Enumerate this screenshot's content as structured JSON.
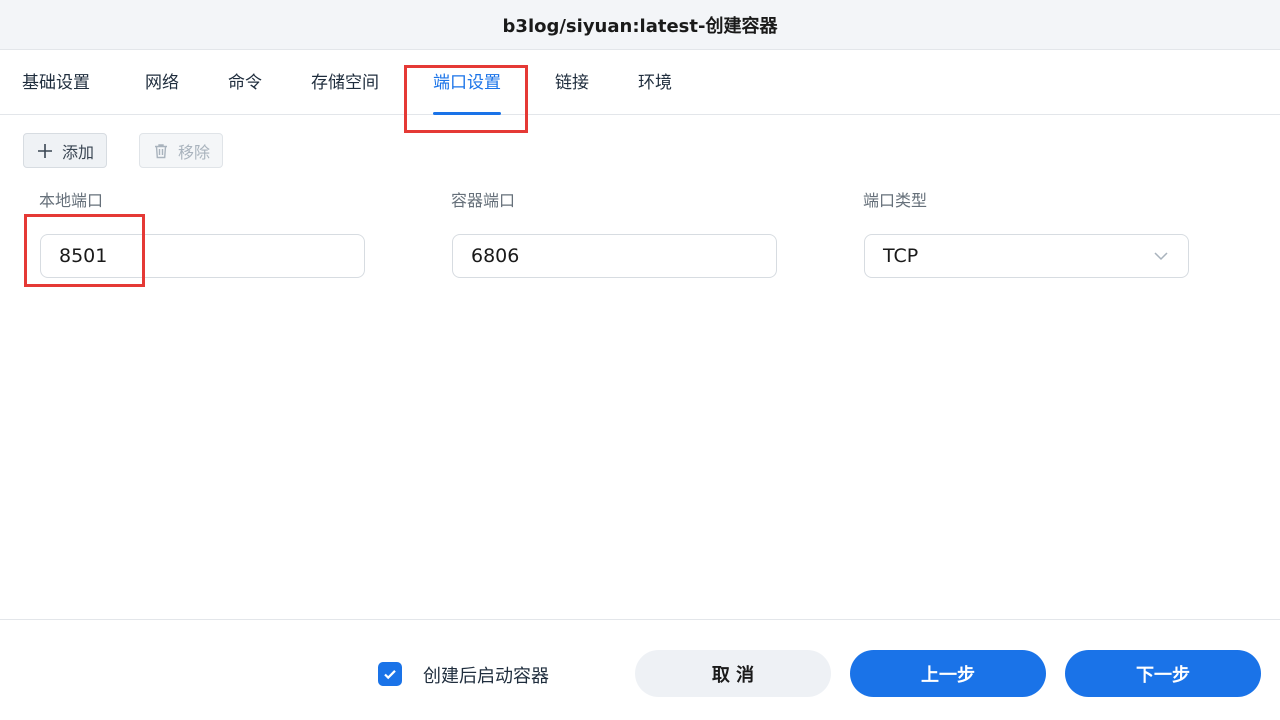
{
  "window": {
    "title": "b3log/siyuan:latest-创建容器"
  },
  "tabs": [
    {
      "label": "基础设置"
    },
    {
      "label": "网络"
    },
    {
      "label": "命令"
    },
    {
      "label": "存储空间"
    },
    {
      "label": "端口设置",
      "active": true
    },
    {
      "label": "链接"
    },
    {
      "label": "环境"
    }
  ],
  "toolbar": {
    "add_label": "添加",
    "remove_label": "移除"
  },
  "port_mapping": {
    "local_port_label": "本地端口",
    "container_port_label": "容器端口",
    "type_label": "端口类型",
    "local_port_value": "8501",
    "container_port_value": "6806",
    "type_value": "TCP"
  },
  "footer": {
    "start_after_create_label": "创建后启动容器",
    "start_after_create_checked": true,
    "cancel_label": "取 消",
    "prev_label": "上一步",
    "next_label": "下一步"
  },
  "colors": {
    "accent": "#1a73e8",
    "highlight": "#e53935"
  },
  "icons": [
    "plus-icon",
    "trash-icon",
    "chevron-down-icon",
    "check-icon"
  ]
}
